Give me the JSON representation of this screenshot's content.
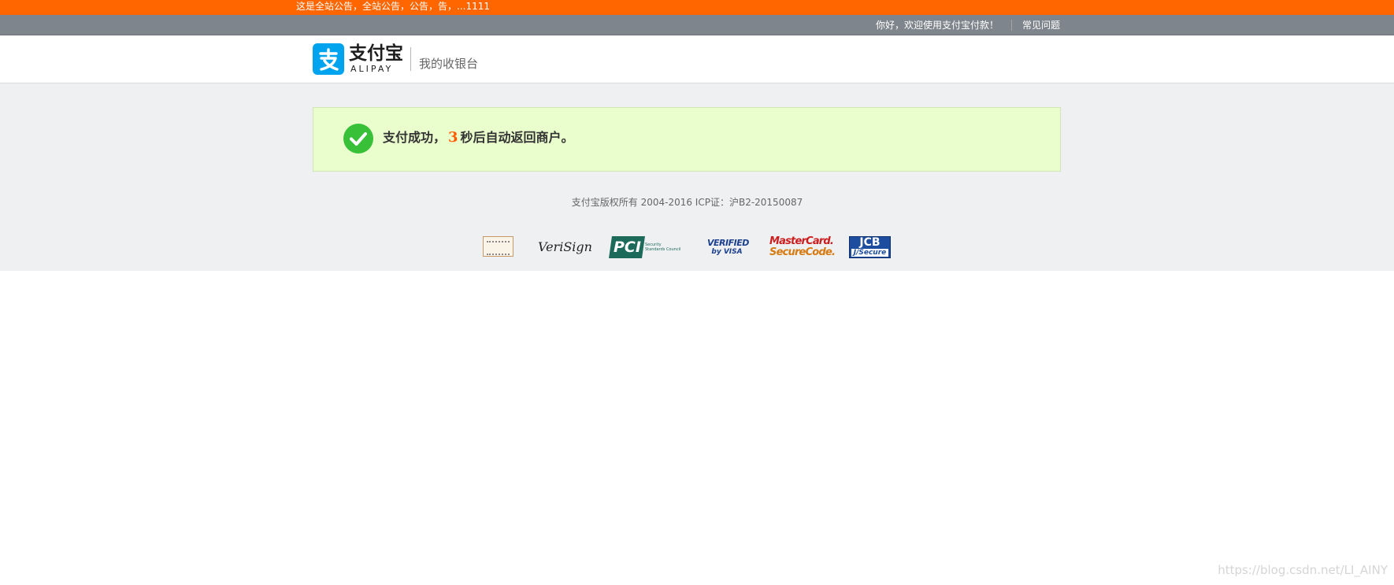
{
  "notice": {
    "text": "这是全站公告，全站公告，公告，告，...1111"
  },
  "top_nav": {
    "welcome": "你好，欢迎使用支付宝付款！",
    "faq_label": "常见问题"
  },
  "header": {
    "logo_cn": "支付宝",
    "logo_en": "ALIPAY",
    "cashier_title": "我的收银台"
  },
  "result": {
    "prefix": "支付成功，",
    "countdown": "3",
    "suffix": "秒后自动返回商户。",
    "status_color": "#38c038",
    "countdown_color": "#ff5a00"
  },
  "footer": {
    "copyright": "支付宝版权所有 2004-2016 ICP证：沪B2-20150087"
  },
  "badges": {
    "verisign": "VeriSign",
    "pci_main": "PCI",
    "pci_sub1": "Security",
    "pci_sub2": "Standards Council",
    "visa_line1": "VERIFIED",
    "visa_line2": "by VISA",
    "mc_line1": "MasterCard.",
    "mc_line2": "SecureCode.",
    "jcb_line1": "JCB",
    "jcb_line2": "J/Secure"
  },
  "watermark": "https://blog.csdn.net/LI_AINY",
  "colors": {
    "notice_bar": "#ff6600",
    "top_nav": "#7f858c",
    "brand_blue": "#00a3ee",
    "success_bg": "#eafdcc",
    "page_gray": "#eff0f2"
  }
}
